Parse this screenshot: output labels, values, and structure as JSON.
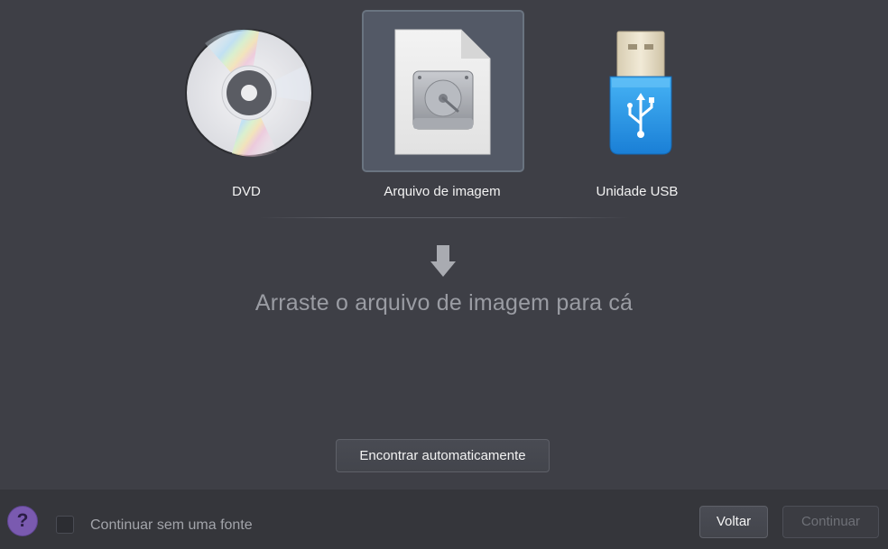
{
  "sources": [
    {
      "id": "dvd",
      "label": "DVD",
      "icon": "dvd-disc-icon",
      "selected": false
    },
    {
      "id": "image",
      "label": "Arquivo de imagem",
      "icon": "disk-image-file-icon",
      "selected": true
    },
    {
      "id": "usb",
      "label": "Unidade USB",
      "icon": "usb-drive-icon",
      "selected": false
    }
  ],
  "drop_zone": {
    "hint": "Arraste o arquivo de imagem para cá",
    "icon": "down-arrow-icon"
  },
  "auto_find_button": "Encontrar automaticamente",
  "footer": {
    "help_label": "?",
    "checkbox_label": "Continuar sem uma fonte",
    "checkbox_checked": false,
    "back_label": "Voltar",
    "continue_label": "Continuar"
  },
  "colors": {
    "background": "#3e3f46",
    "footer_background": "#35363b",
    "selected_tile": "#535966",
    "help_purple": "#7a5ab0",
    "usb_blue": "#1e8fe0"
  }
}
